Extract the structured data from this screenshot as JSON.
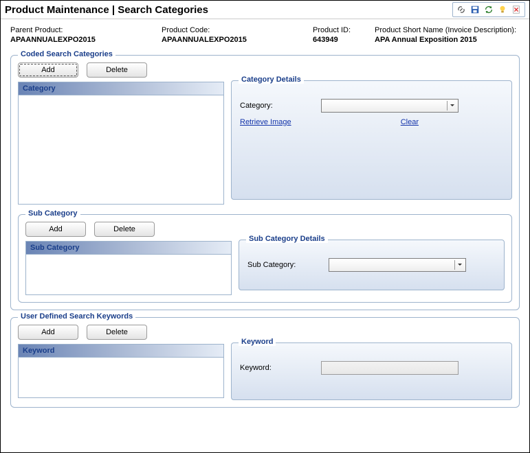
{
  "titlebar": {
    "text": "Product Maintenance  |  Search Categories"
  },
  "info": {
    "parent_product_label": "Parent Product:",
    "parent_product_value": "APAANNUALEXPO2015",
    "product_code_label": "Product Code:",
    "product_code_value": "APAANNUALEXPO2015",
    "product_id_label": "Product ID:",
    "product_id_value": "643949",
    "short_name_label": "Product Short Name (Invoice Description):",
    "short_name_value": "APA Annual Exposition 2015"
  },
  "coded": {
    "legend": "Coded Search Categories",
    "add": "Add",
    "delete": "Delete",
    "list_header": "Category",
    "details_legend": "Category Details",
    "category_label": "Category:",
    "retrieve_link": "Retrieve Image",
    "clear_link": "Clear"
  },
  "subcat": {
    "legend": "Sub Category",
    "add": "Add",
    "delete": "Delete",
    "list_header": "Sub Category",
    "details_legend": "Sub Category Details",
    "subcat_label": "Sub Category:"
  },
  "keywords": {
    "legend": "User Defined Search Keywords",
    "add": "Add",
    "delete": "Delete",
    "list_header": "Keyword",
    "details_legend": "Keyword",
    "keyword_label": "Keyword:"
  }
}
